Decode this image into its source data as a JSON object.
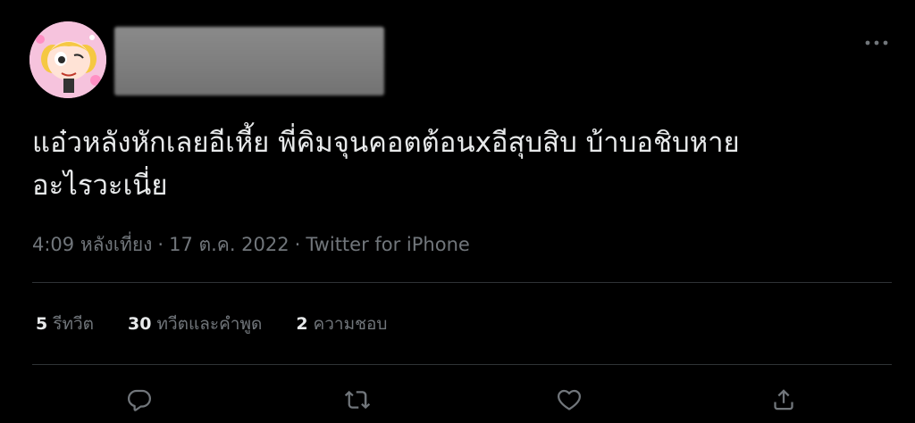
{
  "tweet": {
    "text": "แอ๋วหลังหักเลยอีเหี้ย พี่คิมจุนคอตต้อนxอีสุบสิบ บ้าบอชิบหาย\nอะไรวะเนี่ย",
    "time": "4:09 หลังเที่ยง",
    "date": "17 ต.ค. 2022",
    "separator": "·",
    "source": "Twitter for iPhone"
  },
  "stats": {
    "retweets_count": "5",
    "retweets_label": "รีทวีต",
    "quotes_count": "30",
    "quotes_label": "ทวีตและคำพูด",
    "likes_count": "2",
    "likes_label": "ความชอบ"
  },
  "icons": {
    "more": "more-horizontal-icon",
    "reply": "reply-icon",
    "retweet": "retweet-icon",
    "like": "heart-icon",
    "share": "share-icon"
  },
  "colors": {
    "background": "#000000",
    "text": "#e7e9ea",
    "secondary": "#71767b",
    "divider": "#2f3336"
  }
}
